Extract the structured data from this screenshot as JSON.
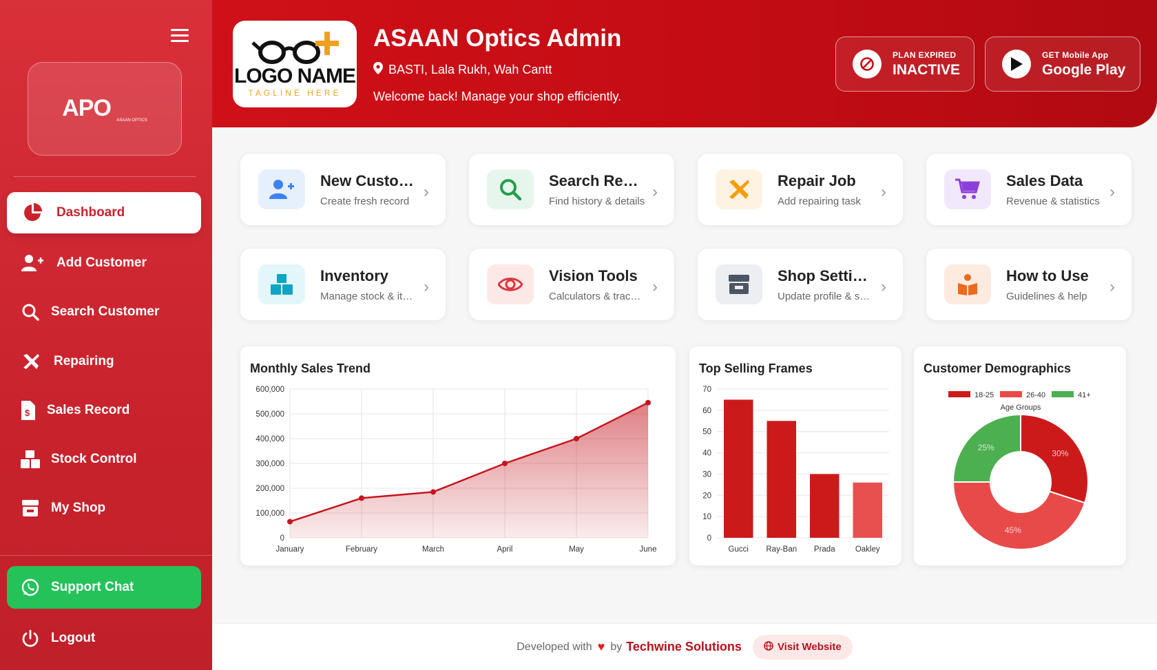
{
  "sidebar": {
    "logo_text": "APO",
    "logo_sub": "ASAAN OPTICS",
    "items": [
      {
        "label": "Dashboard"
      },
      {
        "label": "Add Customer"
      },
      {
        "label": "Search Customer"
      },
      {
        "label": "Repairing"
      },
      {
        "label": "Sales Record"
      },
      {
        "label": "Stock Control"
      },
      {
        "label": "My Shop"
      }
    ],
    "support_label": "Support Chat",
    "logout_label": "Logout"
  },
  "header": {
    "logo_name": "LOGO NAME",
    "logo_tagline": "TAGLINE HERE",
    "title": "ASAAN Optics Admin",
    "address": "BASTI, Lala Rukh, Wah Cantt",
    "welcome": "Welcome back! Manage your shop efficiently.",
    "plan_small": "PLAN EXPIRED",
    "plan_big": "INACTIVE",
    "app_small": "GET Mobile App",
    "app_big": "Google Play"
  },
  "cards": [
    {
      "title": "New Customer",
      "sub": "Create fresh record",
      "icon": "user-plus-icon",
      "color": "#3b82f6"
    },
    {
      "title": "Search Records",
      "sub": "Find history & details",
      "icon": "search-icon",
      "color": "#22a04b"
    },
    {
      "title": "Repair Job",
      "sub": "Add repairing task",
      "icon": "tools-icon",
      "color": "#f59e0b"
    },
    {
      "title": "Sales Data",
      "sub": "Revenue & statistics",
      "icon": "cart-icon",
      "color": "#8b3fd9"
    },
    {
      "title": "Inventory",
      "sub": "Manage stock & items",
      "icon": "boxes-icon",
      "color": "#0ea5c6"
    },
    {
      "title": "Vision Tools",
      "sub": "Calculators & tracking",
      "icon": "eye-icon",
      "color": "#e0353d"
    },
    {
      "title": "Shop Settings",
      "sub": "Update profile & settings",
      "icon": "store-icon",
      "color": "#4b5563"
    },
    {
      "title": "How to Use",
      "sub": "Guidelines & help",
      "icon": "book-reader-icon",
      "color": "#ea6a1f"
    }
  ],
  "charts": {
    "sales": {
      "title": "Monthly Sales Trend"
    },
    "frames": {
      "title": "Top Selling Frames"
    },
    "demo": {
      "title": "Customer Demographics"
    }
  },
  "chart_data": [
    {
      "type": "area",
      "title": "Monthly Sales Trend",
      "categories": [
        "January",
        "February",
        "March",
        "April",
        "May",
        "June"
      ],
      "values": [
        65000,
        160000,
        185000,
        300000,
        400000,
        545000
      ],
      "ylim": [
        0,
        600000
      ],
      "yticks": [
        0,
        100000,
        200000,
        300000,
        400000,
        500000,
        600000
      ],
      "ytick_labels": [
        "0",
        "100,000",
        "200,000",
        "300,000",
        "400,000",
        "500,000",
        "600,000"
      ],
      "color": "#c4161f",
      "grid": true
    },
    {
      "type": "bar",
      "title": "Top Selling Frames",
      "categories": [
        "Gucci",
        "Ray-Ban",
        "Prada",
        "Oakley"
      ],
      "values": [
        65,
        55,
        30,
        26
      ],
      "ylim": [
        0,
        70
      ],
      "yticks": [
        0,
        10,
        20,
        30,
        40,
        50,
        60,
        70
      ],
      "colors": [
        "#cc1a1a",
        "#cc1a1a",
        "#cc1a1a",
        "#e85050"
      ],
      "grid": true
    },
    {
      "type": "pie",
      "title": "Customer Demographics",
      "legend_title": "Age Groups",
      "legend_position": "top",
      "labels": [
        "18-25",
        "26-40",
        "41+"
      ],
      "values": [
        30,
        45,
        25
      ],
      "value_labels": [
        "30%",
        "45%",
        "25%"
      ],
      "colors": [
        "#cc1a1a",
        "#e84a4a",
        "#4caf50"
      ]
    }
  ],
  "footer": {
    "developed": "Developed with",
    "by": "by",
    "company": "Techwine Solutions",
    "visit": "Visit Website"
  }
}
